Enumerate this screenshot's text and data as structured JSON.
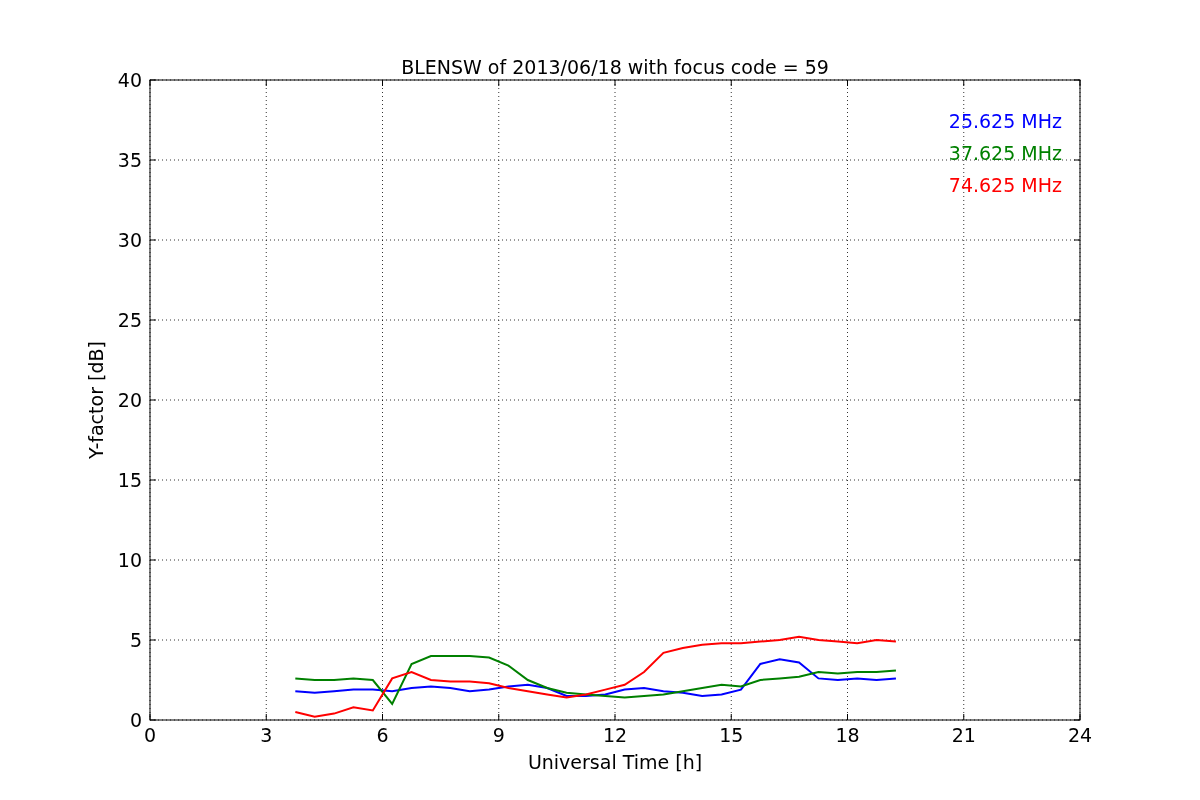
{
  "figure": {
    "chart_data": {
      "type": "line",
      "title": "BLENSW of 2013/06/18 with focus code = 59",
      "xlabel": "Universal Time [h]",
      "ylabel": "Y-factor [dB]",
      "x": [
        3.75,
        4.25,
        4.75,
        5.25,
        5.75,
        6.25,
        6.75,
        7.25,
        7.75,
        8.25,
        8.75,
        9.25,
        9.75,
        10.25,
        10.75,
        11.25,
        11.75,
        12.25,
        12.75,
        13.25,
        13.75,
        14.25,
        14.75,
        15.25,
        15.75,
        16.25,
        16.75,
        17.25,
        17.75,
        18.25,
        18.75,
        19.25
      ],
      "series": [
        {
          "name": "25.625 MHz",
          "color": "#0000ff",
          "values": [
            1.8,
            1.7,
            1.8,
            1.9,
            1.9,
            1.8,
            2.0,
            2.1,
            2.0,
            1.8,
            1.9,
            2.1,
            2.2,
            2.0,
            1.5,
            1.5,
            1.6,
            1.9,
            2.0,
            1.8,
            1.7,
            1.5,
            1.6,
            1.9,
            3.5,
            3.8,
            3.6,
            2.6,
            2.5,
            2.6,
            2.5,
            2.6
          ]
        },
        {
          "name": "37.625 MHz",
          "color": "#008000",
          "values": [
            2.6,
            2.5,
            2.5,
            2.6,
            2.5,
            1.0,
            3.5,
            4.0,
            4.0,
            4.0,
            3.9,
            3.4,
            2.5,
            2.0,
            1.7,
            1.6,
            1.5,
            1.4,
            1.5,
            1.6,
            1.8,
            2.0,
            2.2,
            2.1,
            2.5,
            2.6,
            2.7,
            3.0,
            2.9,
            3.0,
            3.0,
            3.1
          ]
        },
        {
          "name": "74.625 MHz",
          "color": "#ff0000",
          "values": [
            0.5,
            0.2,
            0.4,
            0.8,
            0.6,
            2.6,
            3.0,
            2.5,
            2.4,
            2.4,
            2.3,
            2.0,
            1.8,
            1.6,
            1.4,
            1.6,
            1.9,
            2.2,
            3.0,
            4.2,
            4.5,
            4.7,
            4.8,
            4.8,
            4.9,
            5.0,
            5.2,
            5.0,
            4.9,
            4.8,
            5.0,
            4.9
          ]
        }
      ],
      "grid": true,
      "xlim": [
        0,
        24
      ],
      "ylim": [
        0,
        40
      ],
      "xticks": [
        0,
        3,
        6,
        9,
        12,
        15,
        18,
        21,
        24
      ],
      "yticks": [
        0,
        5,
        10,
        15,
        20,
        25,
        30,
        35,
        40
      ]
    }
  }
}
